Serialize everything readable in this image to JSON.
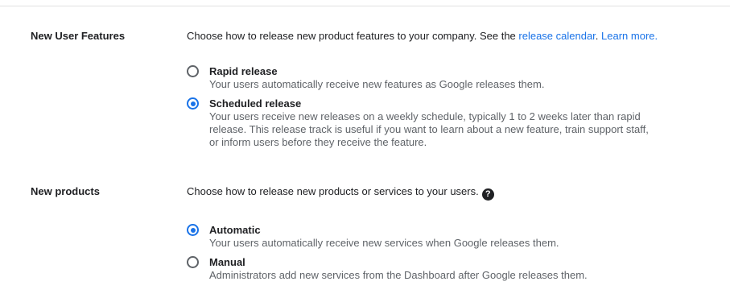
{
  "new_user_features": {
    "label": "New User Features",
    "description_prefix": "Choose how to release new product features to your company. See the ",
    "release_calendar_link": "release calendar",
    "separator": ". ",
    "learn_more_link": "Learn more.",
    "options": [
      {
        "title": "Rapid release",
        "description": "Your users automatically receive new features as Google releases them.",
        "checked": false
      },
      {
        "title": "Scheduled release",
        "description_lines": [
          "Your users receive new releases on a weekly schedule, typically 1 to 2 weeks later than rapid",
          "release. This release track is useful if you want to learn about a new feature, train support staff,",
          "or inform users before they receive the feature."
        ],
        "checked": true
      }
    ]
  },
  "new_products": {
    "label": "New products",
    "description": "Choose how to release new products or services to your users.",
    "help_icon": "help-circle-icon",
    "help_glyph": "?",
    "options": [
      {
        "title": "Automatic",
        "description": "Your users automatically receive new services when Google releases them.",
        "checked": true
      },
      {
        "title": "Manual",
        "description": "Administrators add new services from the Dashboard after Google releases them.",
        "checked": false
      }
    ]
  },
  "colors": {
    "accent": "#1a73e8",
    "text": "#202124",
    "secondary_text": "#5f6368",
    "divider": "#e0e0e0"
  }
}
